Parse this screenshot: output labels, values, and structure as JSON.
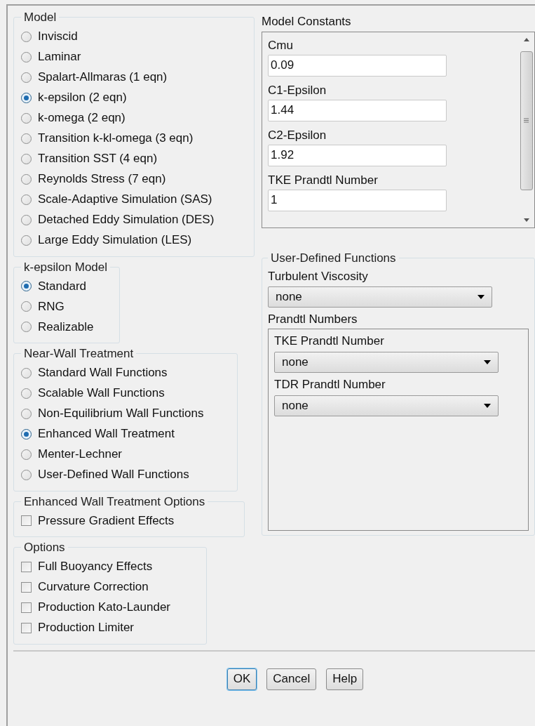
{
  "model": {
    "title": "Model",
    "options": [
      {
        "label": "Inviscid",
        "selected": false
      },
      {
        "label": "Laminar",
        "selected": false
      },
      {
        "label": "Spalart-Allmaras (1 eqn)",
        "selected": false
      },
      {
        "label": "k-epsilon (2 eqn)",
        "selected": true
      },
      {
        "label": "k-omega (2 eqn)",
        "selected": false
      },
      {
        "label": "Transition k-kl-omega (3 eqn)",
        "selected": false
      },
      {
        "label": "Transition SST (4 eqn)",
        "selected": false
      },
      {
        "label": "Reynolds Stress (7 eqn)",
        "selected": false
      },
      {
        "label": "Scale-Adaptive Simulation (SAS)",
        "selected": false
      },
      {
        "label": "Detached Eddy Simulation (DES)",
        "selected": false
      },
      {
        "label": "Large Eddy Simulation (LES)",
        "selected": false
      }
    ]
  },
  "k_epsilon_model": {
    "title": "k-epsilon Model",
    "options": [
      {
        "label": "Standard",
        "selected": true
      },
      {
        "label": "RNG",
        "selected": false
      },
      {
        "label": "Realizable",
        "selected": false
      }
    ]
  },
  "near_wall_treatment": {
    "title": "Near-Wall Treatment",
    "options": [
      {
        "label": "Standard Wall Functions",
        "selected": false
      },
      {
        "label": "Scalable Wall Functions",
        "selected": false
      },
      {
        "label": "Non-Equilibrium Wall Functions",
        "selected": false
      },
      {
        "label": "Enhanced Wall Treatment",
        "selected": true
      },
      {
        "label": "Menter-Lechner",
        "selected": false
      },
      {
        "label": "User-Defined Wall Functions",
        "selected": false
      }
    ]
  },
  "enhanced_wall_treatment_options": {
    "title": "Enhanced Wall Treatment Options",
    "options": [
      {
        "label": "Pressure Gradient Effects",
        "checked": false
      }
    ]
  },
  "options": {
    "title": "Options",
    "options": [
      {
        "label": "Full Buoyancy Effects",
        "checked": false
      },
      {
        "label": "Curvature Correction",
        "checked": false
      },
      {
        "label": "Production Kato-Launder",
        "checked": false
      },
      {
        "label": "Production Limiter",
        "checked": false
      }
    ]
  },
  "model_constants": {
    "title": "Model Constants",
    "fields": [
      {
        "label": "Cmu",
        "value": "0.09"
      },
      {
        "label": "C1-Epsilon",
        "value": "1.44"
      },
      {
        "label": "C2-Epsilon",
        "value": "1.92"
      },
      {
        "label": "TKE Prandtl Number",
        "value": "1"
      }
    ]
  },
  "user_defined_functions": {
    "title": "User-Defined Functions",
    "turbulent_viscosity": {
      "label": "Turbulent Viscosity",
      "value": "none"
    },
    "prandtl_numbers": {
      "title": "Prandtl Numbers",
      "dropdowns": [
        {
          "label": "TKE Prandtl Number",
          "value": "none"
        },
        {
          "label": "TDR Prandtl Number",
          "value": "none"
        }
      ]
    }
  },
  "buttons": [
    {
      "label": "OK",
      "default": true
    },
    {
      "label": "Cancel",
      "default": false
    },
    {
      "label": "Help",
      "default": false
    }
  ]
}
